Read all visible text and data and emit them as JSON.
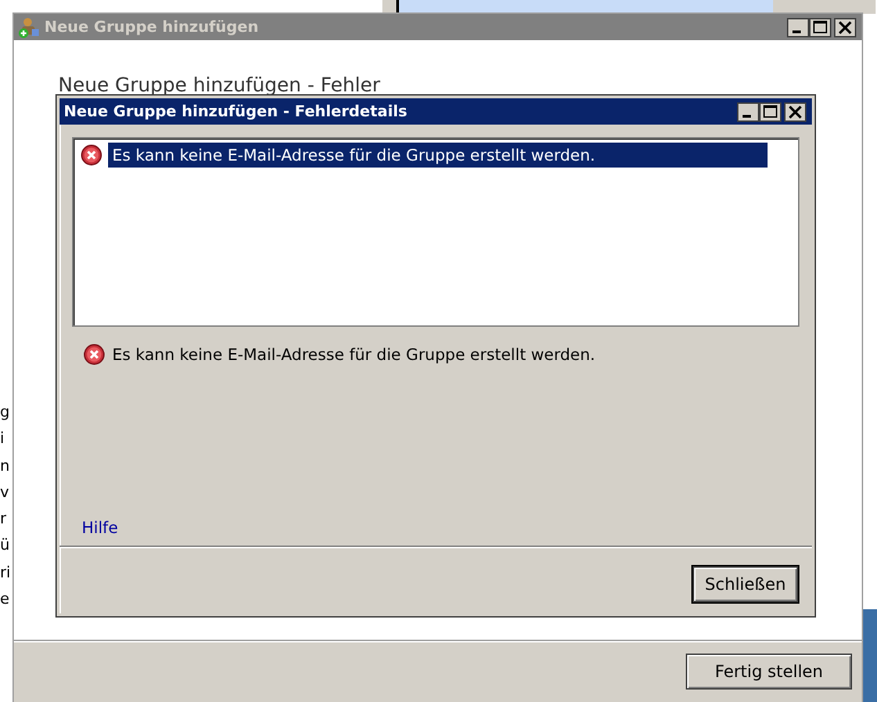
{
  "background_window": {
    "title": "Neue Gruppe hinzufügen",
    "active": false,
    "heading": "Neue Gruppe hinzufügen - Fehler",
    "buttons": [
      "Fertig stellen"
    ]
  },
  "left_fragments": [
    "g",
    "i",
    "n",
    "v",
    "r",
    "ü",
    "ri",
    "e"
  ],
  "dialog": {
    "title": "Neue Gruppe hinzufügen - Fehlerdetails",
    "active": true,
    "errors": [
      {
        "text": "Es kann keine E-Mail-Adresse für die Gruppe erstellt werden.",
        "selected": true
      }
    ],
    "message": "Es kann keine E-Mail-Adresse für die Gruppe erstellt werden.",
    "help_link": "Hilfe",
    "buttons": [
      "Schließen"
    ]
  }
}
